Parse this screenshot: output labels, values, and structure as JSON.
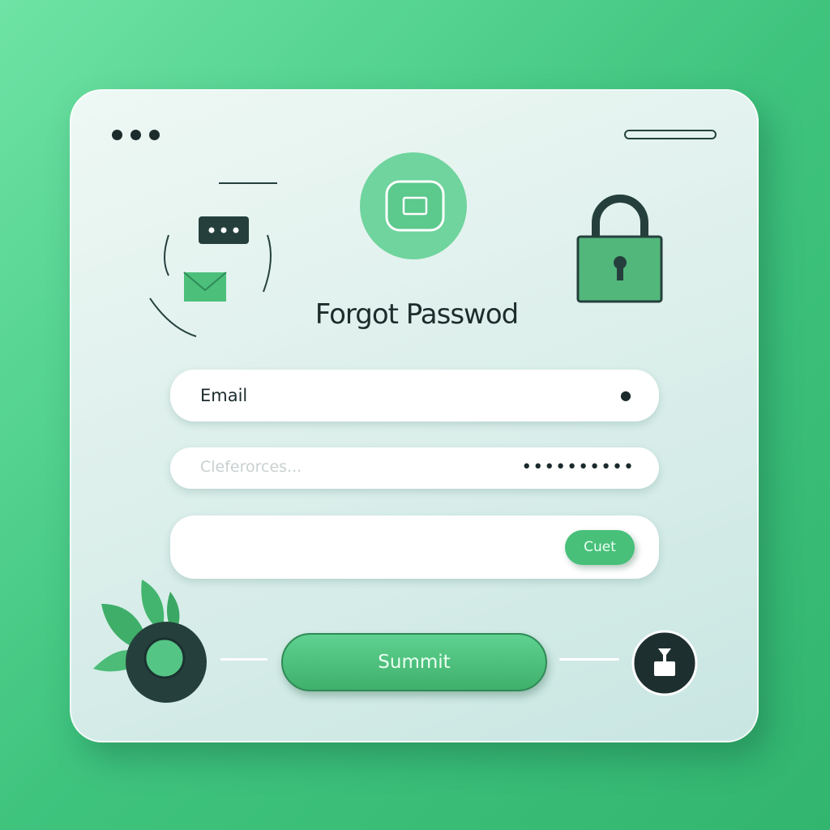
{
  "window": {
    "controls": [
      "dot",
      "dot",
      "dot"
    ]
  },
  "header": {
    "title": "Forgot Passwod"
  },
  "form": {
    "email_label": "Email",
    "password_placeholder": "Cleferorces...",
    "password_value": "••••••••••",
    "cuet_label": "Cuet",
    "submit_label": "Summit"
  },
  "colors": {
    "accent": "#48c07a",
    "dark": "#1c2b2c",
    "background": "#3fc47e"
  },
  "icons": [
    "window-dots-icon",
    "menu-bar-icon",
    "chat-bubble-icon",
    "envelope-icon",
    "app-square-icon",
    "padlock-icon",
    "user-check-icon",
    "leaf-knob-icon",
    "user-lock-icon"
  ]
}
